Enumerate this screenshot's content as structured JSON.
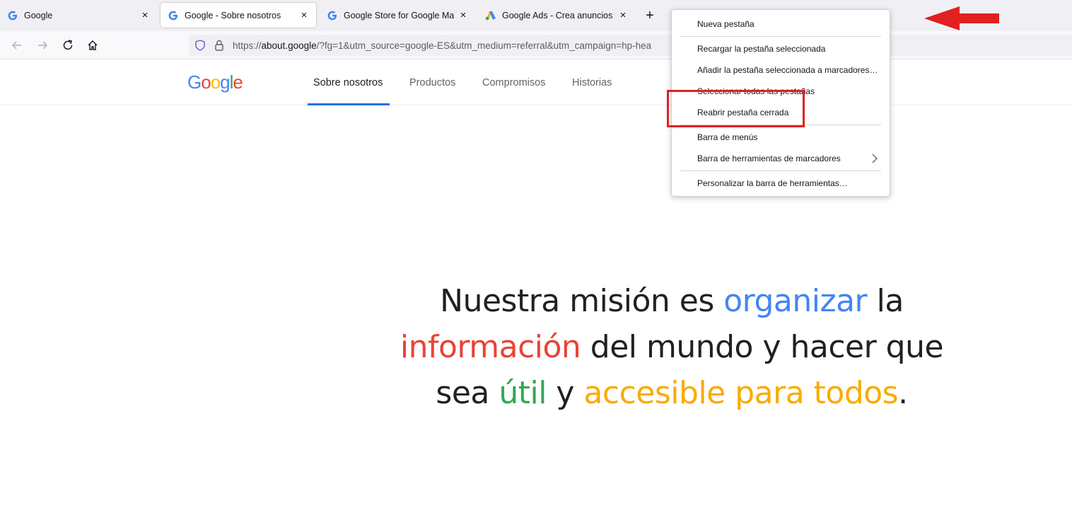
{
  "browser": {
    "tabs": [
      {
        "title": "Google",
        "favicon": "google-g-icon",
        "active": false
      },
      {
        "title": "Google - Sobre nosotros",
        "favicon": "google-g-icon",
        "active": true
      },
      {
        "title": "Google Store for Google Made D",
        "favicon": "google-g-icon",
        "active": false
      },
      {
        "title": "Google Ads - Crea anuncios onl",
        "favicon": "google-ads-icon",
        "active": false
      }
    ],
    "close_glyph": "×",
    "new_tab_glyph": "+",
    "url": {
      "scheme": "https://",
      "domain": "about.google",
      "rest": "/?fg=1&utm_source=google-ES&utm_medium=referral&utm_campaign=hp-hea"
    }
  },
  "site": {
    "logo_letters": [
      "G",
      "o",
      "o",
      "g",
      "l",
      "e"
    ],
    "logo_colors": [
      "#4285f4",
      "#ea4335",
      "#fbbc05",
      "#4285f4",
      "#34a853",
      "#ea4335"
    ],
    "nav": [
      "Sobre nosotros",
      "Productos",
      "Compromisos",
      "Historias"
    ],
    "active_nav": "Sobre nosotros"
  },
  "hero": {
    "parts": [
      "Nuestra misión es ",
      "organizar",
      " la ",
      "información",
      " del mundo y hacer que sea ",
      "útil",
      " y ",
      "accesible para todos",
      "."
    ]
  },
  "context_menu": {
    "items": [
      "Nueva pestaña",
      "Recargar la pestaña seleccionada",
      "Añadir la pestaña seleccionada a marcadores…",
      "Seleccionar todas las pestañas",
      "Reabrir pestaña cerrada",
      "Barra de menús",
      "Barra de herramientas de marcadores",
      "Personalizar la barra de herramientas…"
    ],
    "highlighted_item": "Reabrir pestaña cerrada"
  },
  "colors": {
    "google_blue": "#4285f4",
    "google_red": "#ea4335",
    "google_yellow": "#fbbc05",
    "google_green": "#34a853",
    "annotation_red": "#e1201f"
  }
}
